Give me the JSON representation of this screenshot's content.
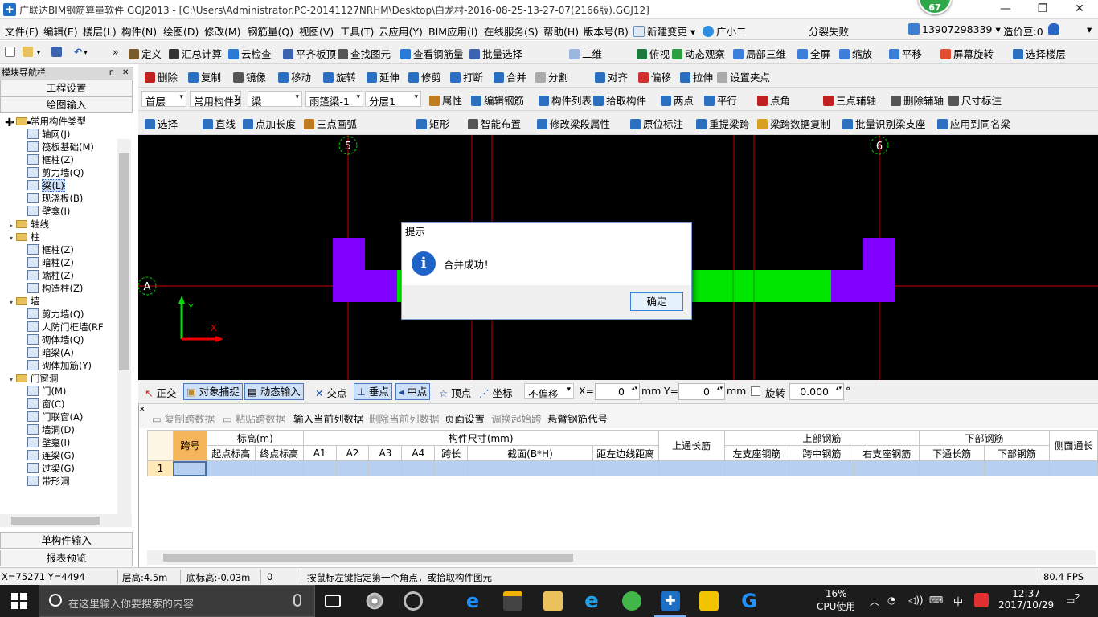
{
  "window": {
    "title": "广联达BIM钢筋算量软件 GGJ2013 - [C:\\Users\\Administrator.PC-20141127NRHM\\Desktop\\白龙村-2016-08-25-13-27-07(2166版).GGJ12]",
    "badge": "67",
    "minimize": "—",
    "maximize": "❐",
    "close": "✕"
  },
  "menubar": {
    "items": [
      "文件(F)",
      "编辑(E)",
      "楼层(L)",
      "构件(N)",
      "绘图(D)",
      "修改(M)",
      "钢筋量(Q)",
      "视图(V)",
      "工具(T)",
      "云应用(Y)",
      "BIM应用(I)",
      "在线服务(S)",
      "帮助(H)",
      "版本号(B)"
    ],
    "new_change": "新建变更",
    "assistant": "广小二",
    "merge_status": "分裂失败",
    "phone": "13907298339",
    "beans": "造价豆:0",
    "bell_icon": "bell-icon",
    "accent": "#1e6fc6"
  },
  "toolbar1": {
    "items": [
      "定义",
      "汇总计算",
      "云检查",
      "平齐板顶",
      "查找图元",
      "查看钢筋量",
      "批量选择",
      "二维",
      "俯视",
      "动态观察",
      "局部三维",
      "全屏",
      "缩放",
      "平移",
      "屏幕旋转",
      "选择楼层"
    ]
  },
  "toolbar2": {
    "items": [
      "删除",
      "复制",
      "镜像",
      "移动",
      "旋转",
      "延伸",
      "修剪",
      "打断",
      "合并",
      "分割",
      "对齐",
      "偏移",
      "拉伸",
      "设置夹点"
    ]
  },
  "toolbar3": {
    "floor": "首层",
    "component_type": "常用构件类",
    "component": "梁",
    "element": "雨篷梁-1",
    "layer": "分层1",
    "items": [
      "属性",
      "编辑钢筋",
      "构件列表",
      "拾取构件",
      "两点",
      "平行",
      "点角",
      "三点辅轴",
      "删除辅轴",
      "尺寸标注"
    ]
  },
  "toolbar4": {
    "items": [
      "选择",
      "直线",
      "点加长度",
      "三点画弧",
      "矩形",
      "智能布置",
      "修改梁段属性",
      "原位标注",
      "重提梁跨",
      "梁跨数据复制",
      "批量识别梁支座",
      "应用到同名梁"
    ]
  },
  "nav": {
    "title": "模块导航栏",
    "pin": "ᴨ",
    "close": "✕",
    "project_settings": "工程设置",
    "draw_input": "绘图输入",
    "single_input": "单构件输入",
    "report_preview": "报表预览",
    "tree": [
      {
        "label": "常用构件类型",
        "level": 0,
        "folder": true,
        "expanded": true
      },
      {
        "label": "轴网(J)",
        "level": 1
      },
      {
        "label": "筏板基础(M)",
        "level": 1
      },
      {
        "label": "框柱(Z)",
        "level": 1
      },
      {
        "label": "剪力墙(Q)",
        "level": 1
      },
      {
        "label": "梁(L)",
        "level": 1,
        "selected": true
      },
      {
        "label": "现浇板(B)",
        "level": 1
      },
      {
        "label": "壁龛(I)",
        "level": 1
      },
      {
        "label": "轴线",
        "level": 0,
        "folder": true,
        "expanded": false
      },
      {
        "label": "柱",
        "level": 0,
        "folder": true,
        "expanded": true
      },
      {
        "label": "框柱(Z)",
        "level": 1
      },
      {
        "label": "暗柱(Z)",
        "level": 1
      },
      {
        "label": "端柱(Z)",
        "level": 1
      },
      {
        "label": "构造柱(Z)",
        "level": 1
      },
      {
        "label": "墙",
        "level": 0,
        "folder": true,
        "expanded": true
      },
      {
        "label": "剪力墙(Q)",
        "level": 1
      },
      {
        "label": "人防门框墙(RF",
        "level": 1
      },
      {
        "label": "砌体墙(Q)",
        "level": 1
      },
      {
        "label": "暗梁(A)",
        "level": 1
      },
      {
        "label": "砌体加筋(Y)",
        "level": 1
      },
      {
        "label": "门窗洞",
        "level": 0,
        "folder": true,
        "expanded": true
      },
      {
        "label": "门(M)",
        "level": 1
      },
      {
        "label": "窗(C)",
        "level": 1
      },
      {
        "label": "门联窗(A)",
        "level": 1
      },
      {
        "label": "墙洞(D)",
        "level": 1
      },
      {
        "label": "壁龛(I)",
        "level": 1
      },
      {
        "label": "连梁(G)",
        "level": 1
      },
      {
        "label": "过梁(G)",
        "level": 1
      },
      {
        "label": "带形洞",
        "level": 1
      }
    ]
  },
  "canvas": {
    "axis_5": "5",
    "axis_6": "6",
    "axis_a": "A",
    "y_label": "Y",
    "x_label": "X",
    "beam_color": "#00e600",
    "column_color": "#7f00ff",
    "axis_color": "#cc0000"
  },
  "dialog": {
    "title": "提示",
    "message": "合并成功！",
    "ok": "确定"
  },
  "snapbar": {
    "ortho": "正交",
    "object_snap": "对象捕捉",
    "dynamic_input": "动态输入",
    "intersection": "交点",
    "perpendicular": "垂点",
    "midpoint": "中点",
    "vertex": "顶点",
    "coordinate": "坐标",
    "offset": "不偏移",
    "x_label": "X=",
    "x_value": "0",
    "mm1": "mm",
    "y_label": "Y=",
    "y_value": "0",
    "mm2": "mm",
    "rotate": "旋转",
    "rotate_value": "0.000",
    "degree": "°"
  },
  "gridtools": {
    "copy_span": "复制跨数据",
    "paste_span": "粘贴跨数据",
    "input_column": "输入当前列数据",
    "delete_column": "删除当前列数据",
    "page_setup": "页面设置",
    "swap_start": "调换起始跨",
    "cantilever": "悬臂钢筋代号"
  },
  "grid": {
    "h_span": "跨号",
    "h_elev": "标高(m)",
    "h_size": "构件尺寸(mm)",
    "h_top_through": "上通长筋",
    "h_top_rebar": "上部钢筋",
    "h_bottom_rebar": "下部钢筋",
    "h_side": "侧面通长",
    "sub": {
      "start": "起点标高",
      "end": "终点标高",
      "a1": "A1",
      "a2": "A2",
      "a3": "A3",
      "a4": "A4",
      "span_len": "跨长",
      "section": "截面(B*H)",
      "edge": "距左边线距离",
      "left_support": "左支座钢筋",
      "mid": "跨中钢筋",
      "right_support": "右支座钢筋",
      "bottom_through": "下通长筋",
      "bottom": "下部钢筋"
    },
    "rows": [
      {
        "no": "1"
      }
    ]
  },
  "status": {
    "coords": "X=75271 Y=4494",
    "floor_height": "层高:4.5m",
    "base_elev": "底标高:-0.03m",
    "zero": "0",
    "hint": "按鼠标左键指定第一个角点，或拾取构件图元",
    "fps": "80.4 FPS"
  },
  "taskbar": {
    "search_placeholder": "在这里输入你要搜索的内容",
    "cpu_percent": "16%",
    "cpu_label": "CPU使用",
    "ime": "中",
    "time": "12:37",
    "date": "2017/10/29",
    "notifications": "2"
  }
}
